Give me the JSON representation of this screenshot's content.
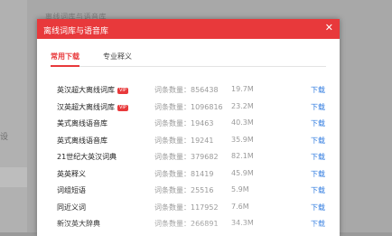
{
  "background": {
    "top_text": "离线词库与语音库",
    "side_char": "设"
  },
  "dialog": {
    "title": "离线词库与语音库",
    "close_icon": "close-icon",
    "tabs": [
      {
        "label": "常用下载",
        "active": true
      },
      {
        "label": "专业释义",
        "active": false
      }
    ],
    "items": [
      {
        "name": "英汉超大离线词库",
        "vip": "VIP",
        "count": "词条数量：856438",
        "size": "19.7M",
        "action": "下载"
      },
      {
        "name": "汉英超大离线词库",
        "vip": "VIP",
        "count": "词条数量：1096816",
        "size": "23.2M",
        "action": "下载"
      },
      {
        "name": "美式离线语音库",
        "vip": "",
        "count": "词条数量：19463",
        "size": "40.3M",
        "action": "下载"
      },
      {
        "name": "英式离线语音库",
        "vip": "",
        "count": "词条数量：19241",
        "size": "35.9M",
        "action": "下载"
      },
      {
        "name": "21世纪大英汉词典",
        "vip": "",
        "count": "词条数量：379682",
        "size": "82.1M",
        "action": "下载"
      },
      {
        "name": "英英释义",
        "vip": "",
        "count": "词条数量：81419",
        "size": "45.9M",
        "action": "下载"
      },
      {
        "name": "词组短语",
        "vip": "",
        "count": "词条数量：25516",
        "size": "5.9M",
        "action": "下载"
      },
      {
        "name": "同近义词",
        "vip": "",
        "count": "词条数量：117952",
        "size": "7.6M",
        "action": "下载"
      },
      {
        "name": "新汉英大辞典",
        "vip": "",
        "count": "词条数量：266891",
        "size": "34.3M",
        "action": "下载"
      }
    ]
  },
  "colors": {
    "accent": "#e8393b",
    "link": "#2f7be0",
    "muted": "#9a9a9a"
  }
}
